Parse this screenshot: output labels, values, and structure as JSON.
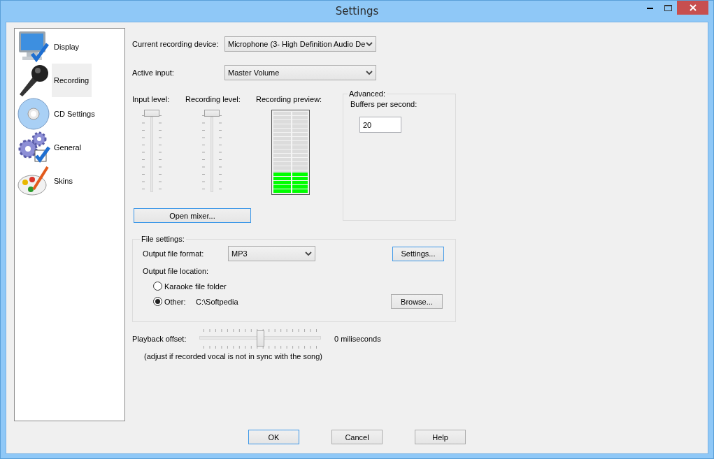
{
  "window": {
    "title": "Settings"
  },
  "sidebar": {
    "items": [
      {
        "label": "Display",
        "kind": "display",
        "selected": false
      },
      {
        "label": "Recording",
        "kind": "recording",
        "selected": true
      },
      {
        "label": "CD Settings",
        "kind": "cd",
        "selected": false
      },
      {
        "label": "General",
        "kind": "general",
        "selected": false
      },
      {
        "label": "Skins",
        "kind": "skins",
        "selected": false
      }
    ]
  },
  "recording": {
    "device": {
      "label": "Current recording device:",
      "value": "Microphone (3- High Definition Audio De"
    },
    "active_input": {
      "label": "Active input:",
      "value": "Master Volume"
    },
    "sliders": [
      {
        "label": "Input level:",
        "level": 1
      },
      {
        "label": "Recording level:",
        "level": 1
      }
    ],
    "preview": {
      "label": "Recording preview:",
      "level": 0.25
    },
    "open_mixer": {
      "label": "Open mixer...",
      "focused": true
    },
    "advanced": {
      "title": "Advanced:",
      "buffers_label": "Buffers per second:",
      "buffers_value": "20"
    }
  },
  "file_settings": {
    "title": "File settings:",
    "format_label": "Output file format:",
    "format_value": "MP3",
    "settings_button": {
      "label": "Settings...",
      "focused": true
    },
    "location_label": "Output file location:",
    "options": [
      {
        "label": "Karaoke file folder",
        "selected": false
      },
      {
        "label": "Other:",
        "selected": true,
        "path": "C:\\Softpedia"
      }
    ],
    "browse_button": {
      "label": "Browse...",
      "focused": false
    }
  },
  "playback": {
    "label": "Playback offset:",
    "level": 0.5,
    "reading": "0 miliseconds",
    "hint": "(adjust if recorded vocal is not in sync with the song)"
  },
  "buttons": [
    {
      "label": "OK",
      "focused": true
    },
    {
      "label": "Cancel",
      "focused": false
    },
    {
      "label": "Help",
      "focused": false
    }
  ]
}
